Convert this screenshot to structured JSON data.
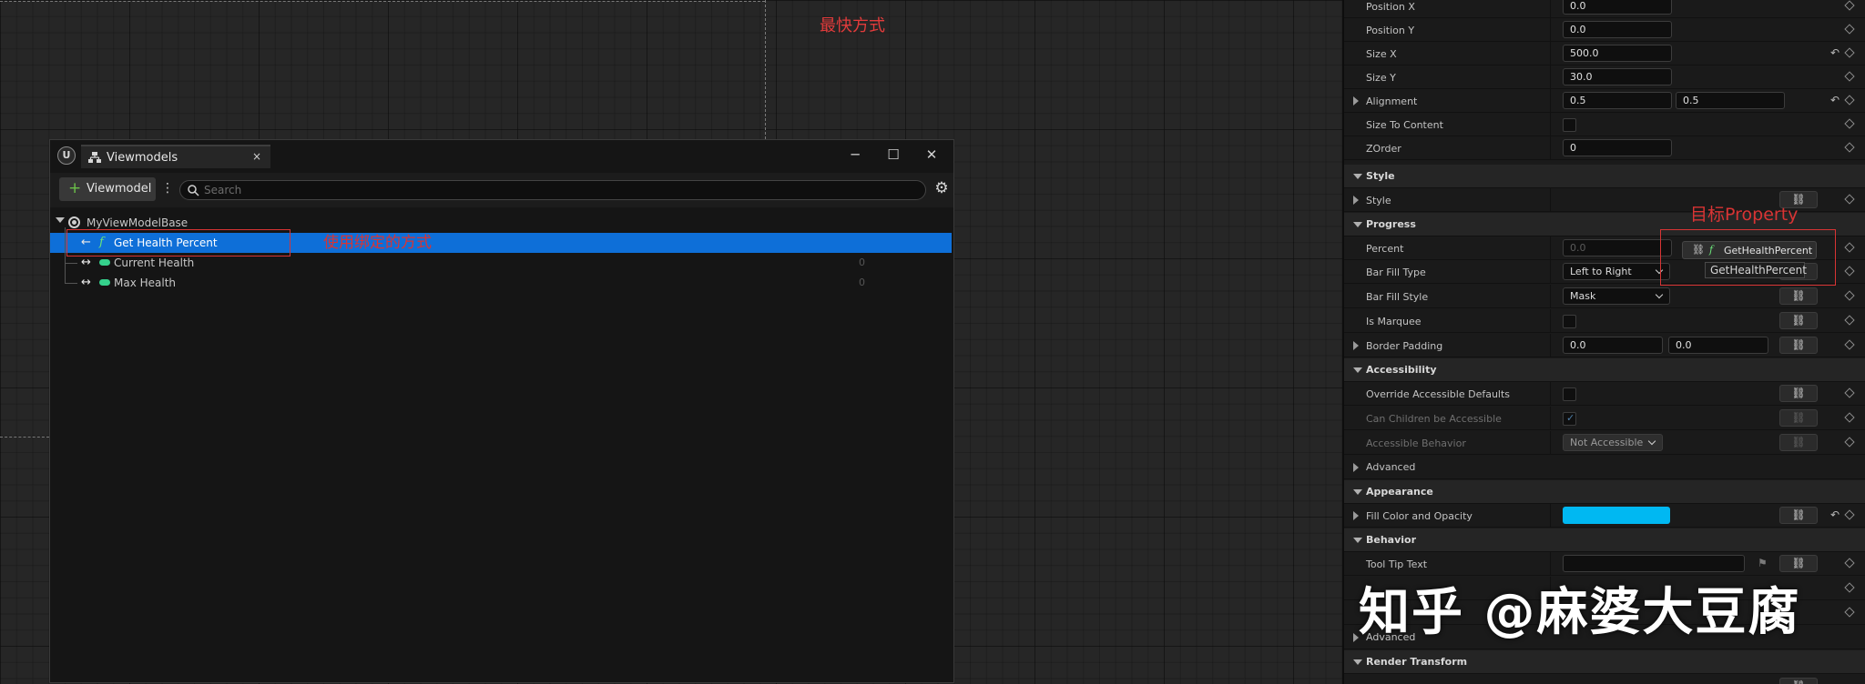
{
  "canvas": {
    "note": "最快方式"
  },
  "vm_window": {
    "tab_label": "Viewmodels",
    "tab_close": "×",
    "controls": {
      "minimize": "─",
      "maximize": "☐",
      "close": "✕"
    },
    "toolbar": {
      "add_label": "Viewmodel",
      "add_plus": "+",
      "menu": "⋮",
      "search_placeholder": "Search",
      "settings": "⚙"
    },
    "tree": {
      "root": "MyViewModelBase",
      "items": [
        {
          "label": "Get Health Percent",
          "arrow": "←",
          "icon": "function-icon",
          "fx": "f",
          "value": ""
        },
        {
          "label": "Current Health",
          "arrow": "↔",
          "icon": "float-pill-icon",
          "value": "0"
        },
        {
          "label": "Max Health",
          "arrow": "↔",
          "icon": "float-pill-icon",
          "value": "0"
        }
      ]
    },
    "annotation": "使用绑定的方式"
  },
  "details": {
    "rows": {
      "position_x": {
        "name": "Position X",
        "value": "0.0"
      },
      "position_y": {
        "name": "Position Y",
        "value": "0.0"
      },
      "size_x": {
        "name": "Size X",
        "value": "500.0"
      },
      "size_y": {
        "name": "Size Y",
        "value": "30.0"
      },
      "alignment": {
        "name": "Alignment",
        "x": "0.5",
        "y": "0.5"
      },
      "size_to_content": {
        "name": "Size To Content"
      },
      "zorder": {
        "name": "ZOrder",
        "value": "0"
      },
      "style": {
        "name": "Style"
      },
      "percent": {
        "name": "Percent",
        "value": "0.0"
      },
      "bar_fill_type": {
        "name": "Bar Fill Type",
        "value": "Left to Right"
      },
      "bar_fill_style": {
        "name": "Bar Fill Style",
        "value": "Mask"
      },
      "is_marquee": {
        "name": "Is Marquee"
      },
      "border_padding": {
        "name": "Border Padding",
        "left": "0.0",
        "right": "0.0"
      },
      "override_access": {
        "name": "Override Accessible Defaults"
      },
      "children_access": {
        "name": "Can Children be Accessible"
      },
      "access_behavior": {
        "name": "Accessible Behavior",
        "value": "Not Accessible"
      },
      "fill_color": {
        "name": "Fill Color and Opacity",
        "color": "#00b8f2"
      },
      "tooltip_text": {
        "name": "Tool Tip Text"
      }
    },
    "sections": {
      "style": "Style",
      "progress": "Progress",
      "accessibility": "Accessibility",
      "advanced1": "Advanced",
      "appearance": "Appearance",
      "behavior": "Behavior",
      "advanced2": "Advanced",
      "render_transform": "Render Transform"
    },
    "binding_button": {
      "label": "GetHealthPercent",
      "link": "⛓",
      "fx": "f"
    },
    "tooltip": "GetHealthPercent",
    "annotation": "目标Property",
    "link_glyph": "⛓",
    "reset_glyph": "↶",
    "flag_glyph": "⚑",
    "tick_glyph": "✓"
  },
  "watermark": "知乎 @麻婆大豆腐",
  "colors": {
    "selection": "#0e6fd8",
    "annotation_red": "#d83434",
    "fill_color": "#00b8f2"
  }
}
